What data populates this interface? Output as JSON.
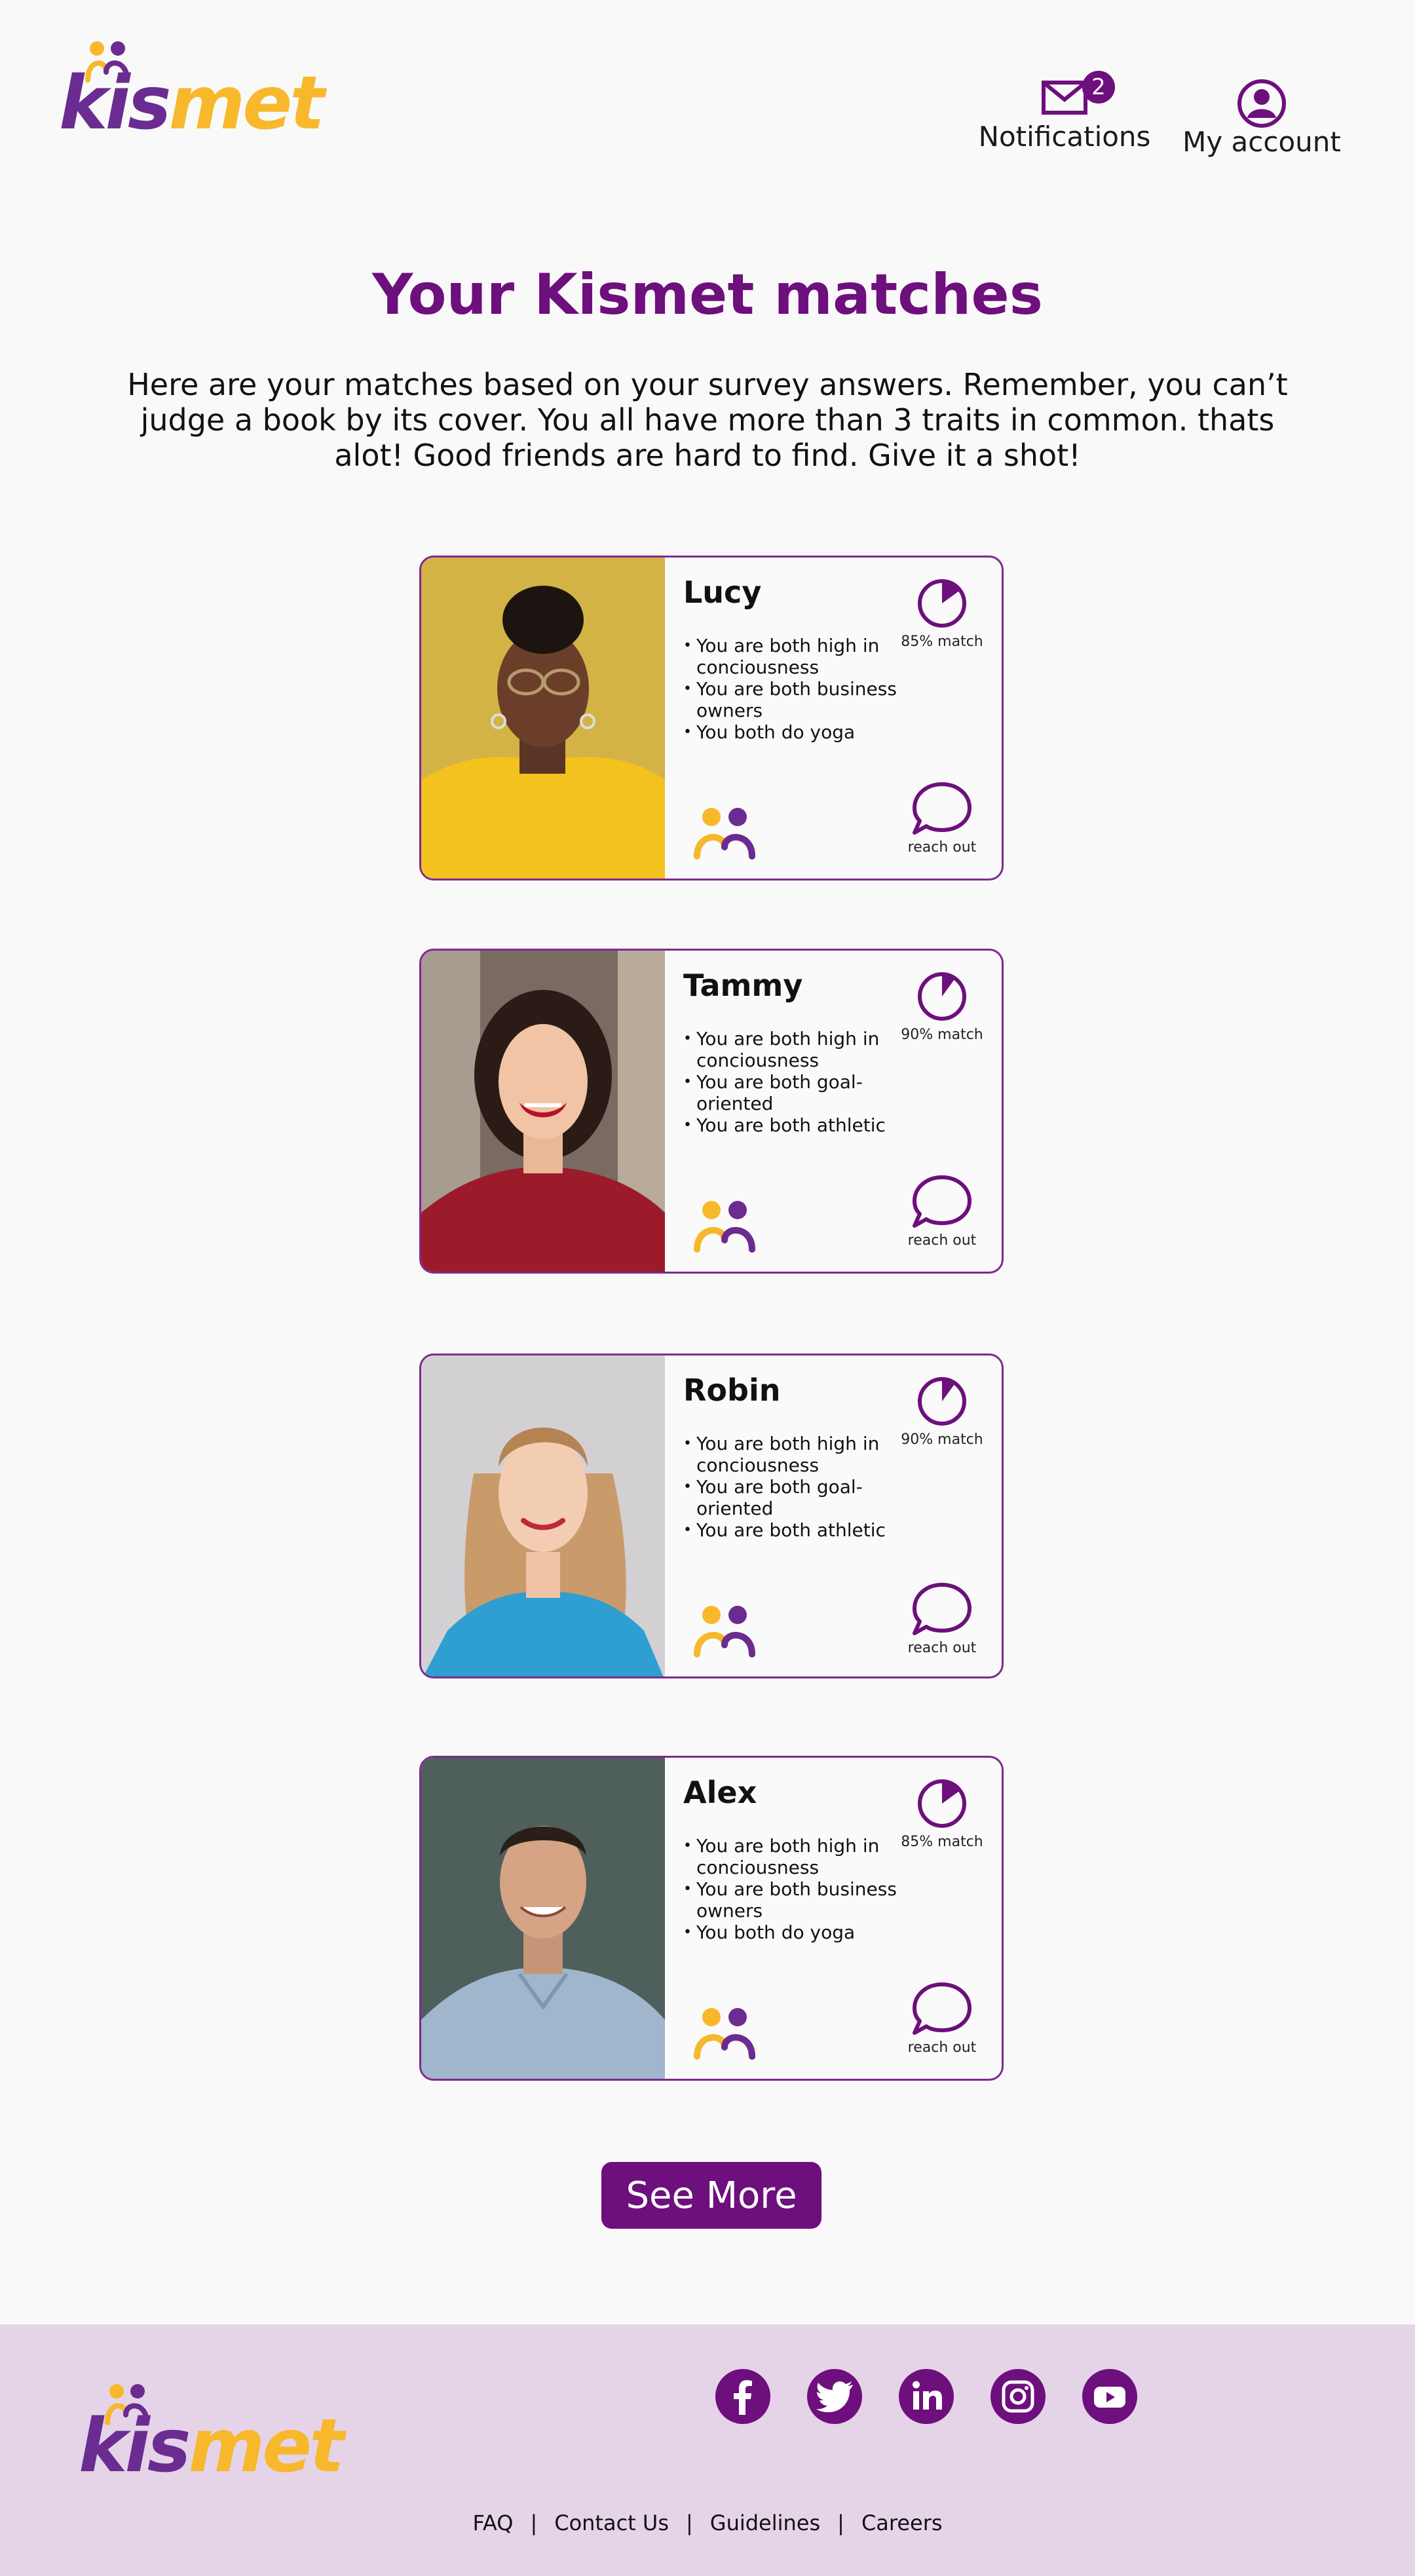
{
  "header": {
    "logo_part1": "kis",
    "logo_part2": "met",
    "notifications_label": "Notifications",
    "notifications_count": "2",
    "account_label": "My account"
  },
  "main": {
    "title": "Your Kismet matches",
    "intro": "Here are your matches based on your survey answers. Remember, you can’t judge a book by its cover. You all have more than 3 traits in common. thats alot! Good friends are hard to find. Give it a shot!"
  },
  "matches": [
    {
      "name": "Lucy",
      "match_label": "85% match",
      "match_fraction": 0.85,
      "traits": [
        "You are both high in conciousness",
        "You are both business owners",
        "You both do yoga"
      ],
      "reach_label": "reach out"
    },
    {
      "name": "Tammy",
      "match_label": "90% match",
      "match_fraction": 0.9,
      "traits": [
        "You are both high in conciousness",
        "You are both goal-oriented",
        "You are both athletic"
      ],
      "reach_label": "reach out"
    },
    {
      "name": "Robin",
      "match_label": "90% match",
      "match_fraction": 0.9,
      "traits": [
        "You are both high in conciousness",
        "You are both goal-oriented",
        "You are both athletic"
      ],
      "reach_label": "reach out"
    },
    {
      "name": "Alex",
      "match_label": "85% match",
      "match_fraction": 0.85,
      "traits": [
        "You are both high in conciousness",
        "You are both business owners",
        "You both do yoga"
      ],
      "reach_label": "reach out"
    }
  ],
  "see_more_label": "See More",
  "footer": {
    "logo_part1": "kis",
    "logo_part2": "met",
    "social": [
      "facebook-icon",
      "twitter-icon",
      "linkedin-icon",
      "instagram-icon",
      "youtube-icon"
    ],
    "links": [
      "FAQ",
      "Contact Us",
      "Guidelines",
      "Careers"
    ]
  },
  "colors": {
    "brand_purple": "#6d0f7c",
    "logo_purple": "#6a2c91",
    "logo_yellow": "#f7b82b",
    "footer_bg": "#e5d3e8"
  }
}
